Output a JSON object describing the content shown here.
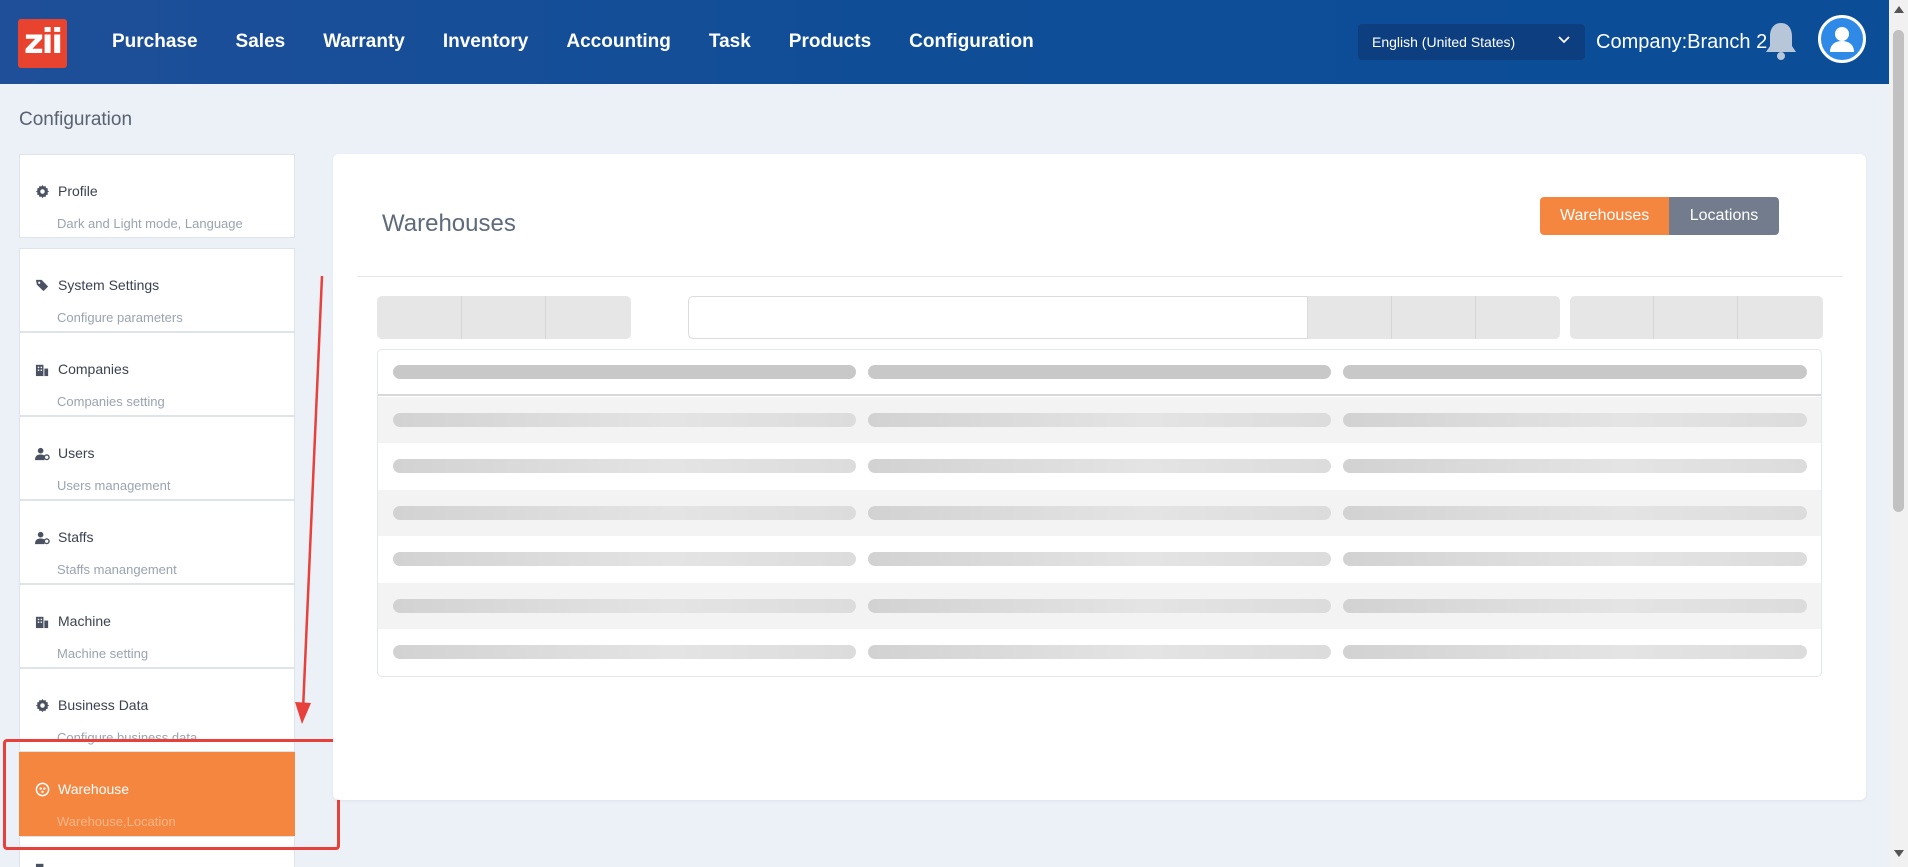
{
  "app": {
    "logo_text": "zii",
    "brand_color": "#e8432f",
    "accent_color": "#f58640"
  },
  "nav": {
    "items": [
      {
        "label": "Purchase"
      },
      {
        "label": "Sales"
      },
      {
        "label": "Warranty"
      },
      {
        "label": "Inventory"
      },
      {
        "label": "Accounting"
      },
      {
        "label": "Task"
      },
      {
        "label": "Products"
      },
      {
        "label": "Configuration"
      }
    ],
    "language": "English (United States)",
    "company": "Company:Branch 2"
  },
  "page": {
    "title": "Configuration"
  },
  "sidebar": {
    "items": [
      {
        "label": "Profile",
        "sub": "Dark and Light mode, Language",
        "icon": "gear-icon"
      },
      {
        "label": "System Settings",
        "sub": "Configure parameters",
        "icon": "tags-icon"
      },
      {
        "label": "Companies",
        "sub": "Companies setting",
        "icon": "building-icon"
      },
      {
        "label": "Users",
        "sub": "Users management",
        "icon": "user-gear-icon"
      },
      {
        "label": "Staffs",
        "sub": "Staffs manangement",
        "icon": "user-gear-icon"
      },
      {
        "label": "Machine",
        "sub": "Machine setting",
        "icon": "building-icon"
      },
      {
        "label": "Business Data",
        "sub": "Configure business data",
        "icon": "gear-icon"
      },
      {
        "label": "Warehouse",
        "sub": "Warehouse,Location",
        "icon": "warehouse-icon",
        "active": true
      }
    ]
  },
  "main": {
    "title": "Warehouses",
    "toggle": {
      "active": "Warehouses",
      "inactive": "Locations"
    }
  }
}
